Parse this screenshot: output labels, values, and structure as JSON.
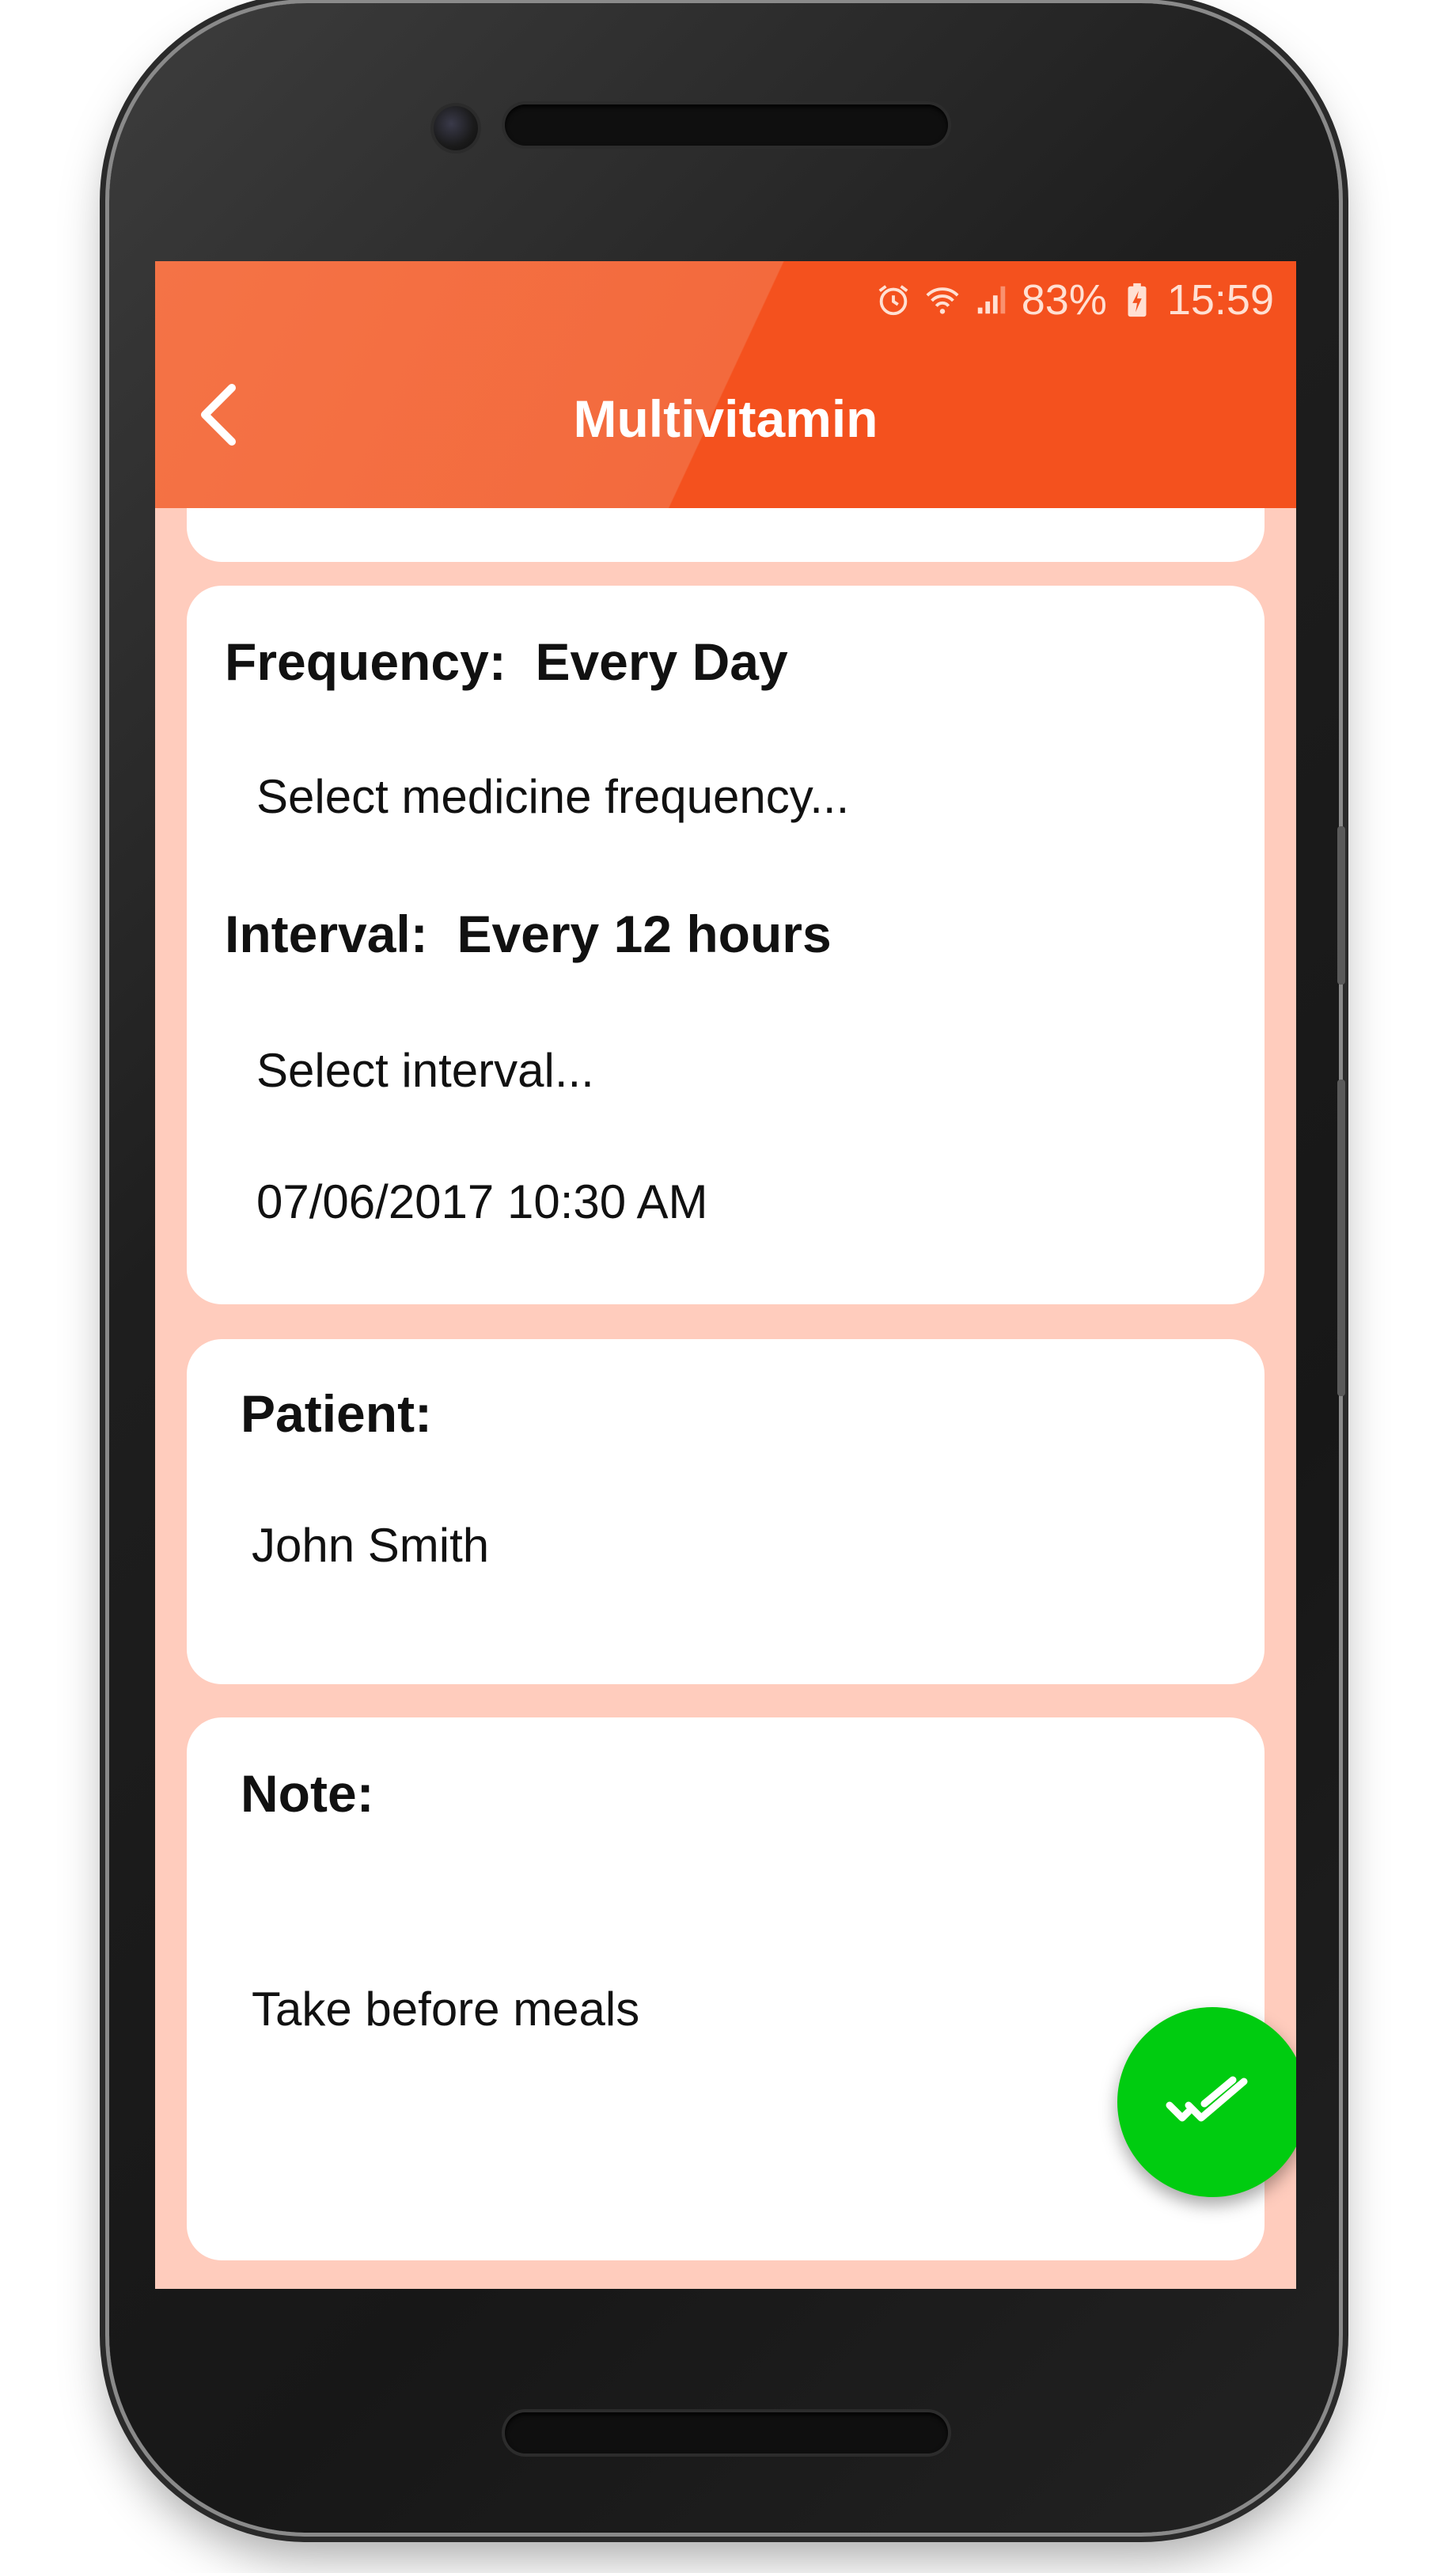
{
  "status_bar": {
    "battery": "83%",
    "time": "15:59",
    "icons": [
      "alarm-icon",
      "wifi-icon",
      "signal-icon",
      "battery-charging-icon"
    ]
  },
  "app_bar": {
    "title": "Multivitamin",
    "back_icon": "chevron-left-icon"
  },
  "schedule_card": {
    "frequency_label": "Frequency:",
    "frequency_value": "Every Day",
    "frequency_select": "Select medicine frequency...",
    "interval_label": "Interval:",
    "interval_value": "Every 12 hours",
    "interval_select": "Select interval...",
    "start_datetime": "07/06/2017 10:30 AM"
  },
  "patient_card": {
    "label": "Patient:",
    "value": "John Smith"
  },
  "note_card": {
    "label": "Note:",
    "value": "Take before meals"
  },
  "fab": {
    "icon": "double-check-icon"
  },
  "colors": {
    "app_bar": "#f4511e",
    "background": "#ffccbd",
    "fab": "#00cc10"
  }
}
